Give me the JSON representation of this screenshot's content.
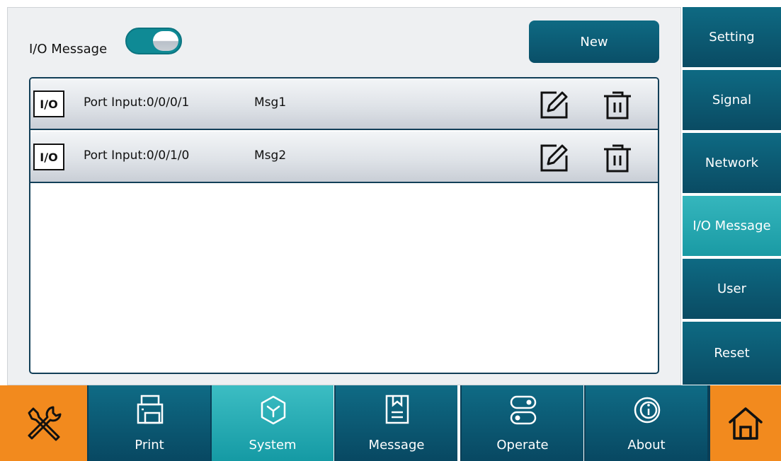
{
  "io_switch": {
    "label": "I/O Message",
    "state": "on"
  },
  "new_button": {
    "label": "New"
  },
  "messages": [
    {
      "badge": "I/O",
      "port": "Port Input:0/0/0/1",
      "name": "Msg1"
    },
    {
      "badge": "I/O",
      "port": "Port Input:0/0/1/0",
      "name": "Msg2"
    }
  ],
  "sidebar": {
    "items": [
      {
        "label": "Setting"
      },
      {
        "label": "Signal"
      },
      {
        "label": "Network"
      },
      {
        "label": "I/O Message",
        "active": true
      },
      {
        "label": "User"
      },
      {
        "label": "Reset"
      }
    ]
  },
  "bottom_nav": {
    "tabs": [
      {
        "label": "Print",
        "icon": "printer-icon"
      },
      {
        "label": "System",
        "icon": "cube-icon",
        "active": true
      },
      {
        "label": "Message",
        "icon": "document-icon"
      },
      {
        "label": "Operate",
        "icon": "switches-icon"
      },
      {
        "label": "About",
        "icon": "info-icon"
      }
    ],
    "left_button_icon": "tools-icon",
    "right_button_icon": "home-icon"
  },
  "colors": {
    "primary": "#0e6a83",
    "active": "#1a9aa4",
    "accent_orange": "#f28a1e",
    "panel_bg": "#eef0f2"
  }
}
